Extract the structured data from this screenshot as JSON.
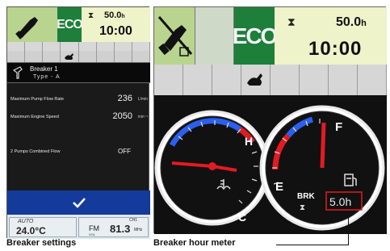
{
  "left_panel": {
    "eco_label": "ECO",
    "hours": "50.0",
    "hours_unit": "h",
    "time": "10:00",
    "breaker_name": "Breaker 1",
    "breaker_type": "Type - A",
    "settings": [
      {
        "label": "Maximum Pump Flow Rate",
        "value": "236",
        "unit": "L/min"
      },
      {
        "label": "Maximum Engine Speed",
        "value": "2050",
        "unit": "min⁻¹"
      },
      {
        "label": "2 Pumps Combined Flow",
        "value": "OFF",
        "unit": ""
      }
    ],
    "radio": {
      "auto_label": "AUTO",
      "temperature": "24.0°C",
      "band": "FM",
      "frequency": "81.3",
      "frequency_unit": "MHz",
      "channel": "CH1",
      "vol_label": "VOL"
    }
  },
  "right_panel": {
    "eco_label": "ECO",
    "hours": "50.0",
    "hours_unit": "h",
    "time": "10:00",
    "gauge_labels": {
      "temp_high": "H",
      "temp_cold": "C",
      "fuel_full": "F",
      "fuel_empty": "E"
    },
    "brk_label": "BRK",
    "breaker_hours": "5.0h"
  },
  "captions": {
    "left": "Breaker settings",
    "right": "Breaker hour meter"
  },
  "colors": {
    "eco_bg": "#1d7f3a",
    "clock_bg": "#eef3c9",
    "confirm_bg": "#143a9c",
    "gauge_blue": "#2a5ff0",
    "gauge_red": "#e11b22",
    "highlight_box": "#e11b22"
  },
  "icons": [
    "breaker-attachment-icon",
    "eco-mode-indicator",
    "hourglass-icon",
    "rabbit-speed-icon",
    "checkmark-icon",
    "coolant-temperature-icon",
    "fuel-pump-icon"
  ]
}
